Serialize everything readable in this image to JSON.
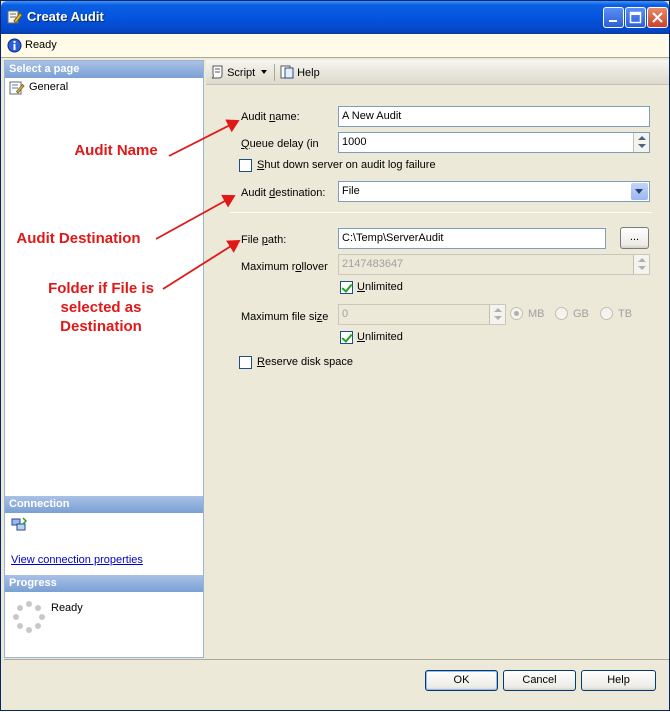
{
  "window": {
    "title": "Create Audit",
    "title_icon": "audit-wizard-icon",
    "controls": [
      "minimize-icon",
      "maximize-icon",
      "close-icon"
    ]
  },
  "status": {
    "icon": "info-icon",
    "text": "Ready"
  },
  "left_panel": {
    "select_page_header": "Select a page",
    "pages": [
      {
        "label": "General",
        "icon": "page-properties-icon"
      }
    ],
    "connection_header": "Connection",
    "connection_icon": "server-connection-icon",
    "connection_link": "View connection properties",
    "progress_header": "Progress",
    "progress_icon": "progress-spinner-icon",
    "progress_text": "Ready"
  },
  "toolbar": {
    "script_label": "Script",
    "script_icon": "script-icon",
    "help_label": "Help",
    "help_icon": "help-icon"
  },
  "form": {
    "audit_name": {
      "label": "Audit name:",
      "value": "A New Audit"
    },
    "queue_delay": {
      "label": "Queue delay (in",
      "value": "1000"
    },
    "shutdown": {
      "label": "Shut down server on audit log failure",
      "checked": false
    },
    "audit_destination": {
      "label": "Audit destination:",
      "value": "File"
    },
    "file_path": {
      "label": "File path:",
      "value": "C:\\Temp\\ServerAudit",
      "browse_label": "..."
    },
    "max_rollover": {
      "label": "Maximum rollover",
      "value": "2147483647",
      "unlimited_label": "Unlimited",
      "unlimited_checked": true
    },
    "max_file_size": {
      "label": "Maximum file size",
      "value": "0",
      "units": [
        "MB",
        "GB",
        "TB"
      ],
      "selected_unit": "MB",
      "unlimited_label": "Unlimited",
      "unlimited_checked": true
    },
    "reserve_disk": {
      "label": "Reserve disk space",
      "checked": false
    }
  },
  "buttons": {
    "ok": "OK",
    "cancel": "Cancel",
    "help": "Help"
  },
  "annotations": {
    "audit_name": "Audit Name",
    "audit_destination": "Audit Destination",
    "folder": [
      "Folder if File is",
      "selected as",
      "Destination"
    ],
    "color": "#e01818"
  }
}
